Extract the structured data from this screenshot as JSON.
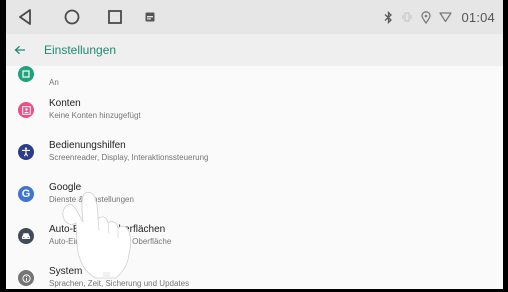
{
  "status": {
    "time": "01:04"
  },
  "appbar": {
    "title": "Einstellungen"
  },
  "items": [
    {
      "title": "",
      "subtitle": "An",
      "color": "#1fa37a",
      "icon": "square-icon"
    },
    {
      "title": "Konten",
      "subtitle": "Keine Konten hinzugefügt",
      "color": "#ec4f84",
      "icon": "account-icon"
    },
    {
      "title": "Bedienungshilfen",
      "subtitle": "Screenreader, Display, Interaktionssteuerung",
      "color": "#2c3c8e",
      "icon": "accessibility-icon"
    },
    {
      "title": "Google",
      "subtitle": "Dienste & Einstellungen",
      "color": "#3f73d4",
      "icon": "google-icon"
    },
    {
      "title": "Auto-Benutzeroberflächen",
      "subtitle": "Auto-Einstellungen der Oberfläche",
      "color": "#424c58",
      "icon": "car-icon"
    },
    {
      "title": "System",
      "subtitle": "Sprachen, Zeit, Sicherung und Updates",
      "color": "#757575",
      "icon": "info-icon"
    }
  ],
  "colors": {
    "accent": "#1f8a6f",
    "statusbar": "#e6e6e6",
    "appbar": "#efefef"
  }
}
